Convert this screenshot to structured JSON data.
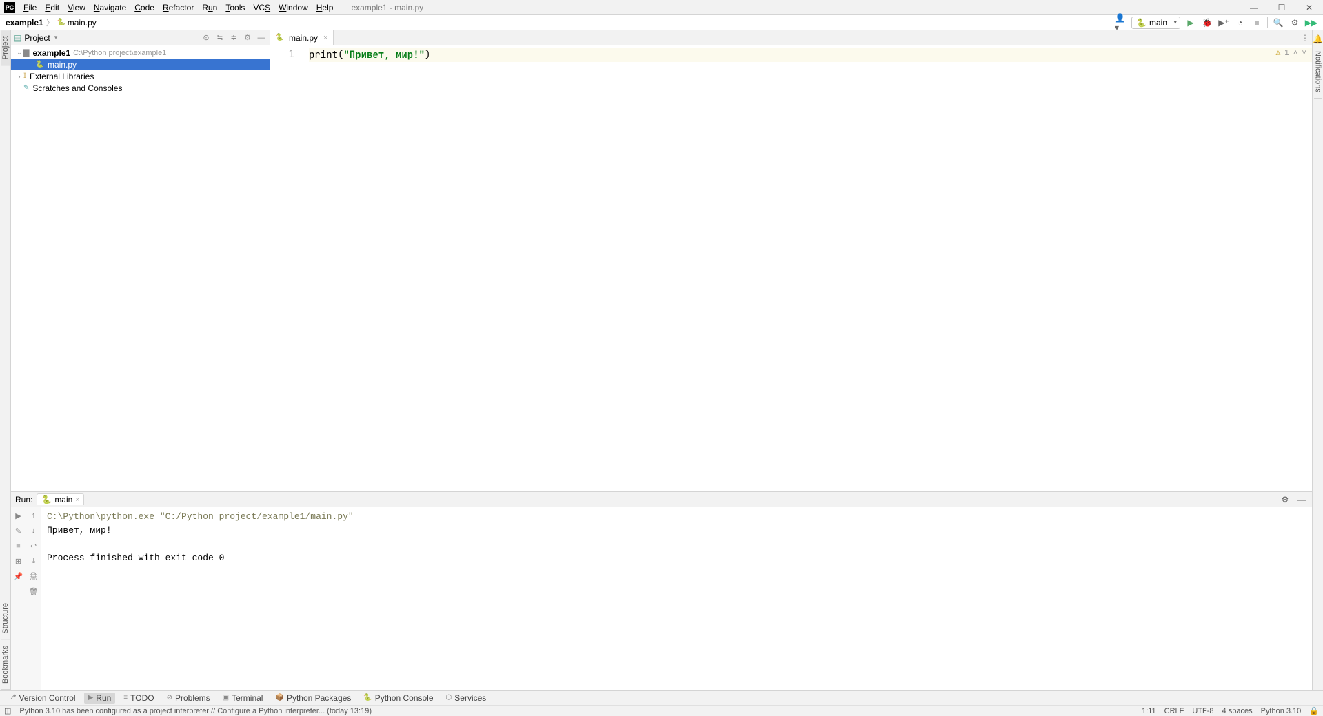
{
  "window_title": "example1 - main.py",
  "menu": {
    "file": "File",
    "edit": "Edit",
    "view": "View",
    "navigate": "Navigate",
    "code": "Code",
    "refactor": "Refactor",
    "run": "Run",
    "tools": "Tools",
    "vcs": "VCS",
    "window": "Window",
    "help": "Help"
  },
  "breadcrumb": {
    "root": "example1",
    "file": "main.py"
  },
  "run_config": {
    "name": "main"
  },
  "project_panel": {
    "title": "Project",
    "root": {
      "name": "example1",
      "path": "C:\\Python project\\example1"
    },
    "file": "main.py",
    "external_libraries": "External Libraries",
    "scratches": "Scratches and Consoles"
  },
  "editor": {
    "tab": "main.py",
    "line1_num": "1",
    "code_fn": "print",
    "code_open": "(",
    "code_str": "\"Привет, мир!\"",
    "code_close": ")",
    "lint_count": "1"
  },
  "run_panel": {
    "title": "Run:",
    "tab": "main",
    "cmd": "C:\\Python\\python.exe \"C:/Python project/example1/main.py\"",
    "out1": "Привет, мир!",
    "out2": "",
    "exit": "Process finished with exit code 0"
  },
  "bottom_tabs": {
    "version_control": "Version Control",
    "run": "Run",
    "todo": "TODO",
    "problems": "Problems",
    "terminal": "Terminal",
    "python_packages": "Python Packages",
    "python_console": "Python Console",
    "services": "Services"
  },
  "left_tabs": {
    "project": "Project",
    "bookmarks": "Bookmarks",
    "structure": "Structure"
  },
  "right_tabs": {
    "notifications": "Notifications"
  },
  "status": {
    "msg": "Python 3.10 has been configured as a project interpreter // Configure a Python interpreter... (today 13:19)",
    "pos": "1:11",
    "sep": "CRLF",
    "enc": "UTF-8",
    "indent": "4 spaces",
    "interp": "Python 3.10"
  }
}
